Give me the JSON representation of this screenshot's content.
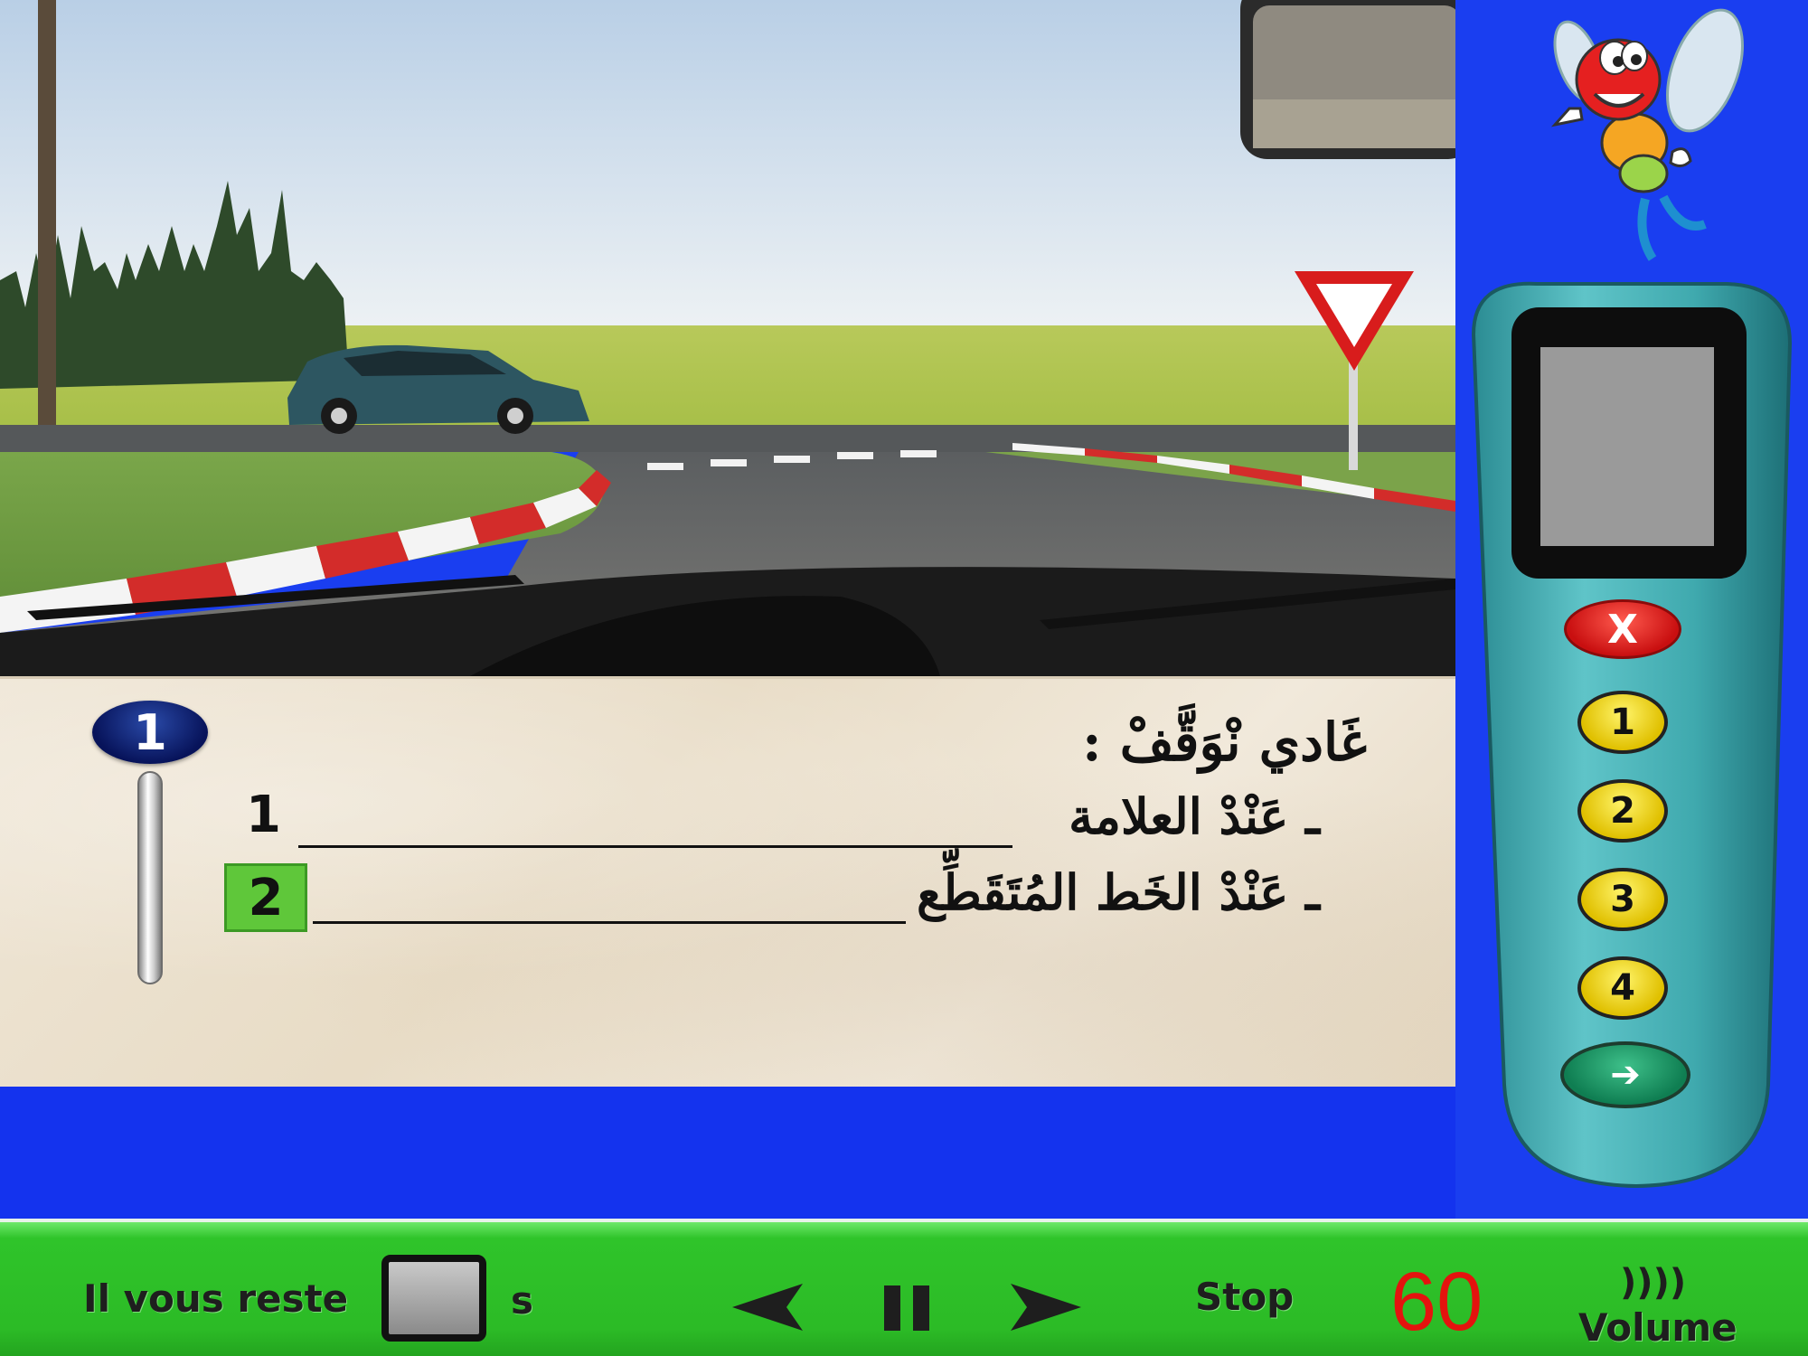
{
  "question": {
    "number": "1",
    "title": "غَادي نْوَقَّفْ :",
    "answers": [
      {
        "number": "1",
        "text": "ـ عَنْدْ العلامة",
        "selected": false
      },
      {
        "number": "2",
        "text": "ـ عَنْدْ الخَط المُتَقَطِّع",
        "selected": true
      }
    ]
  },
  "remote": {
    "cancel_label": "X",
    "answer_buttons": [
      "1",
      "2",
      "3",
      "4"
    ],
    "next_icon": "arrow-right-icon"
  },
  "bottom_bar": {
    "remaining_label": "Il vous reste",
    "seconds_unit": "s",
    "stop_label": "Stop",
    "count": "60",
    "volume_label": "Volume",
    "volume_icon": "speaker-waves-icon"
  },
  "colors": {
    "background_blue": "#1a3ef0",
    "bar_green": "#2fc42a",
    "selected_green": "#5fc73a",
    "count_red": "#e4130e",
    "remote_teal": "#3fa9ae"
  }
}
